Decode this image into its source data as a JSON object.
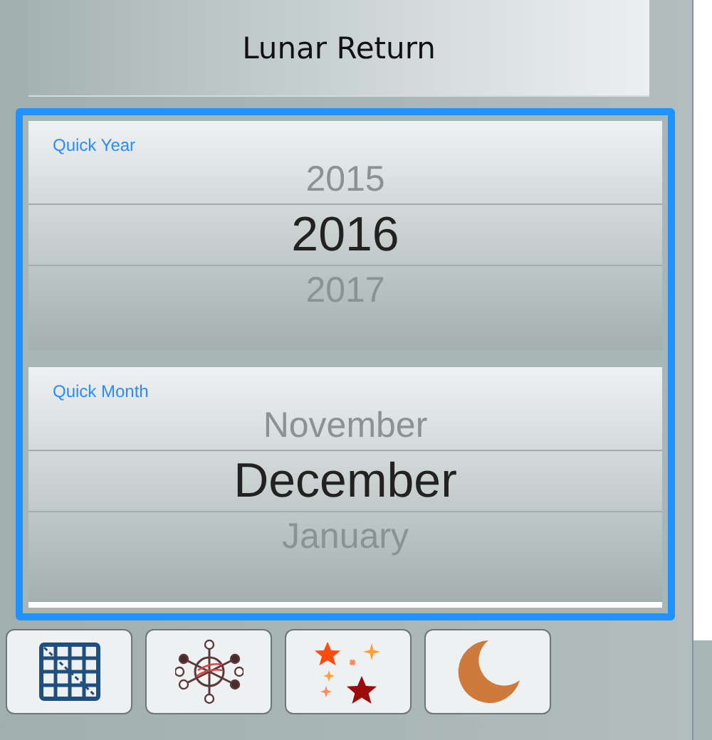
{
  "title": "Lunar Return",
  "pickers": [
    {
      "label": "Quick Year",
      "options": [
        {
          "text": "2015",
          "selected": false
        },
        {
          "text": "2016",
          "selected": true
        },
        {
          "text": "2017",
          "selected": false
        }
      ]
    },
    {
      "label": "Quick Month",
      "options": [
        {
          "text": "November",
          "selected": false
        },
        {
          "text": "December",
          "selected": true
        },
        {
          "text": "January",
          "selected": false
        }
      ]
    }
  ],
  "toolbar": [
    {
      "kind": "grid"
    },
    {
      "kind": "wheel"
    },
    {
      "kind": "stars"
    },
    {
      "kind": "moon"
    }
  ]
}
